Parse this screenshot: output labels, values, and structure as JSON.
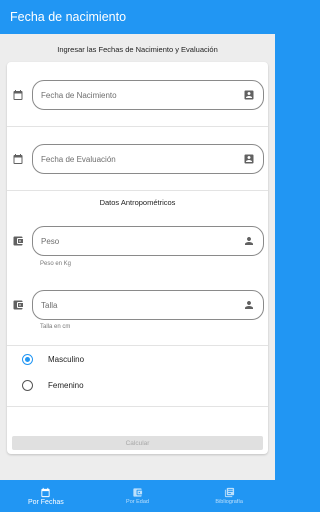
{
  "appbar": {
    "title": "Fecha de nacimiento"
  },
  "main": {
    "subtitle": "Ingresar las Fechas de Nacimiento y Evaluación",
    "birth_date": {
      "placeholder": "Fecha de Nacimiento",
      "icon": "calendar-icon",
      "suffix_icon": "contact-card-icon"
    },
    "eval_date": {
      "placeholder": "Fecha de Evaluación",
      "icon": "calendar-icon",
      "suffix_icon": "contact-card-icon"
    },
    "section_title": "Datos Antropométricos",
    "weight": {
      "placeholder": "Peso",
      "helper": "Peso en Kg",
      "icon": "wallet-icon",
      "suffix_icon": "person-icon"
    },
    "height": {
      "placeholder": "Talla",
      "helper": "Talla en cm",
      "icon": "wallet-icon",
      "suffix_icon": "person-icon"
    },
    "sex_options": [
      {
        "label": "Masculino",
        "selected": true
      },
      {
        "label": "Femenino",
        "selected": false
      }
    ],
    "calculate_label": "Calcular"
  },
  "bottom_nav": [
    {
      "label": "Por Fechas",
      "icon": "calendar-icon",
      "active": true
    },
    {
      "label": "Por Edad",
      "icon": "wallet-icon",
      "active": false
    },
    {
      "label": "Bibliografía",
      "icon": "library-books-icon",
      "active": false
    }
  ],
  "colors": {
    "primary": "#2196F3",
    "background": "#EDEDED",
    "card": "#FFFFFF"
  }
}
